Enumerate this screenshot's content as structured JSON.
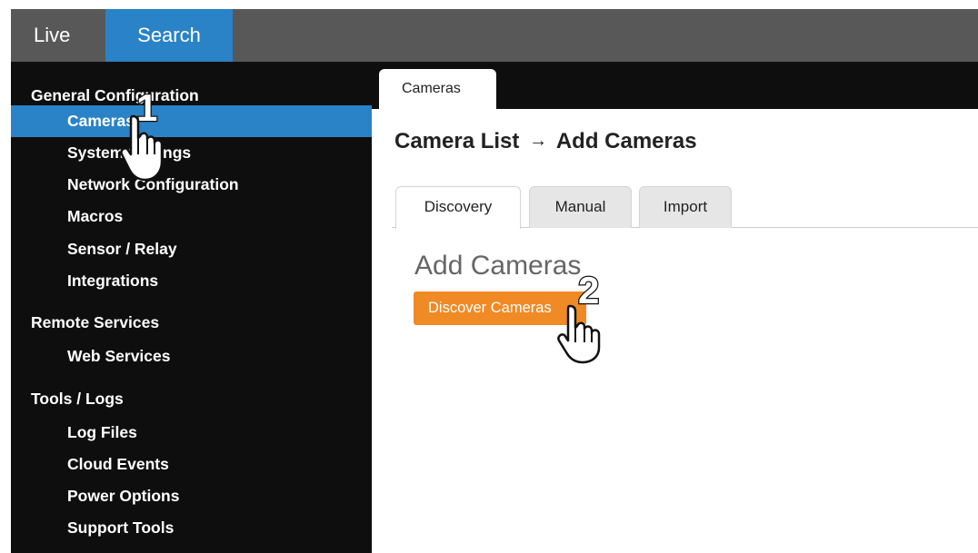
{
  "topnav": {
    "items": [
      {
        "label": "Live",
        "active": false
      },
      {
        "label": "Search",
        "active": true
      }
    ],
    "active_color": "#2a83c6"
  },
  "sidebar": {
    "sections": [
      {
        "title": "General Configuration",
        "items": [
          "Cameras",
          "System Settings",
          "Network Configuration",
          "Macros",
          "Sensor / Relay",
          "Integrations"
        ]
      },
      {
        "title": "Remote Services",
        "items": [
          "Web Services"
        ]
      },
      {
        "title": "Tools / Logs",
        "items": [
          "Log Files",
          "Cloud Events",
          "Power Options",
          "Support Tools"
        ]
      }
    ],
    "active_item": "Cameras"
  },
  "content": {
    "tab": "Cameras",
    "breadcrumb": {
      "parent": "Camera List",
      "arrow": "→",
      "current": "Add Cameras"
    },
    "subtabs": [
      "Discovery",
      "Manual",
      "Import"
    ],
    "active_subtab": "Discovery",
    "heading": "Add Cameras",
    "discover_button": "Discover Cameras",
    "button_color": "#f08a24"
  },
  "annotations": {
    "steps": [
      "1",
      "2"
    ],
    "cursor_icon": "hand-pointer-icon"
  }
}
